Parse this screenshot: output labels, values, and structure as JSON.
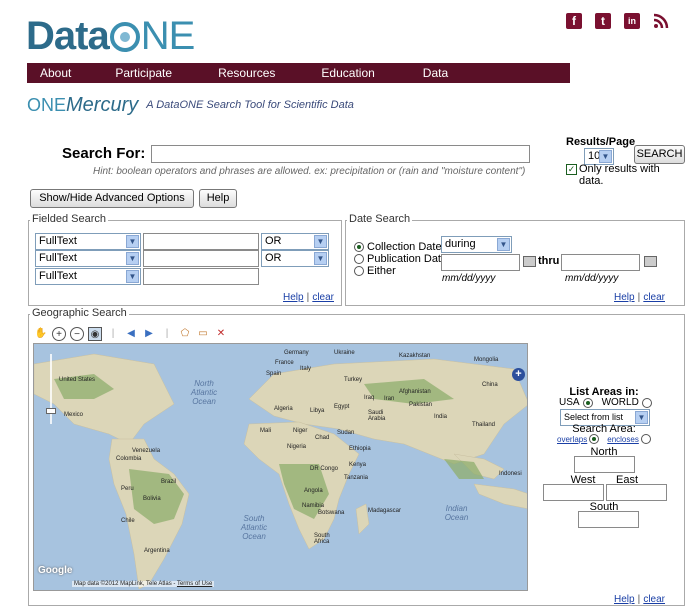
{
  "header": {
    "logo_data": "Data",
    "logo_one": "NE",
    "social": [
      {
        "name": "facebook-icon",
        "glyph": "f"
      },
      {
        "name": "tumblr-icon",
        "glyph": "t"
      },
      {
        "name": "linkedin-icon",
        "glyph": "in"
      },
      {
        "name": "rss-icon",
        "glyph": "ᴲ"
      }
    ]
  },
  "nav": {
    "items": [
      "About",
      "Participate",
      "Resources",
      "Education",
      "Data"
    ]
  },
  "mercury": {
    "one": "ONE",
    "mercury": "Mercury",
    "tagline": "A DataONE Search Tool for Scientific Data"
  },
  "search": {
    "label": "Search For:",
    "value": "",
    "hint": "Hint: boolean operators and phrases are allowed. ex: precipitation or (rain and \"moisture content\")",
    "results_label": "Results/Page",
    "results_value": "10",
    "button": "SEARCH",
    "only_results_label": "Only results with data.",
    "only_results_checked": true
  },
  "buttons": {
    "advanced": "Show/Hide Advanced Options",
    "help": "Help"
  },
  "fielded": {
    "legend": "Fielded Search",
    "rows": [
      {
        "field": "FullText",
        "op": "OR"
      },
      {
        "field": "FullText",
        "op": "OR"
      },
      {
        "field": "FullText",
        "op": ""
      }
    ],
    "help": "Help",
    "sep": "|",
    "clear": "clear"
  },
  "date": {
    "legend": "Date Search",
    "options": [
      "Collection Date",
      "Publication Date",
      "Either"
    ],
    "selected": "Collection Date",
    "mode": "during",
    "thru": "thru",
    "format_from": "mm/dd/yyyy",
    "format_to": "mm/dd/yyyy",
    "help": "Help",
    "sep": "|",
    "clear": "clear"
  },
  "geo": {
    "legend": "Geographic Search",
    "list_areas": "List Areas in:",
    "usa": "USA",
    "world": "WORLD",
    "select_placeholder": "Select from list",
    "search_area": "Search Area:",
    "overlaps": "overlaps",
    "encloses": "encloses",
    "north": "North",
    "west": "West",
    "east": "East",
    "south": "South",
    "help": "Help",
    "sep": "|",
    "clear": "clear"
  },
  "map": {
    "labels": {
      "germany": "Germany",
      "ukraine": "Ukraine",
      "kazakhstan": "Kazakhstan",
      "mongolia": "Mongolia",
      "france": "France",
      "spain": "Spain",
      "italy": "Italy",
      "turkey": "Turkey",
      "china": "China",
      "afghanistan": "Afghanistan",
      "iraq": "Iraq",
      "iran": "Iran",
      "pakistan": "Pakistan",
      "united_states": "United States",
      "algeria": "Algeria",
      "libya": "Libya",
      "egypt": "Egypt",
      "saudi": "Saudi Arabia",
      "india": "India",
      "thailand": "Thailand",
      "mexico": "Mexico",
      "mali": "Mali",
      "niger": "Niger",
      "chad": "Chad",
      "sudan": "Sudan",
      "nigeria": "Nigeria",
      "ethiopia": "Ethiopia",
      "venezuela": "Venezuela",
      "colombia": "Colombia",
      "drcongo": "DR Congo",
      "kenya": "Kenya",
      "tanzania": "Tanzania",
      "indonesia": "Indonesi",
      "brazil": "Brazil",
      "peru": "Peru",
      "bolivia": "Bolivia",
      "angola": "Angola",
      "namibia": "Namibia",
      "botswana": "Botswana",
      "madagascar": "Madagascar",
      "chile": "Chile",
      "south_africa": "South Africa",
      "argentina": "Argentina"
    },
    "oceans": {
      "north_atlantic": "North Atlantic Ocean",
      "south_atlantic": "South Atlantic Ocean",
      "indian": "Indian Ocean"
    },
    "google": "Google",
    "attribution": "Map data ©2012 MapLink, Tele Atlas - ",
    "terms": "Terms of Use"
  },
  "colors": {
    "nav_bg": "#5a1027",
    "brand_blue": "#2d6b8a",
    "ocean": "#a7c3df",
    "land": "#dcd6b8",
    "forest": "#8fae6e"
  }
}
